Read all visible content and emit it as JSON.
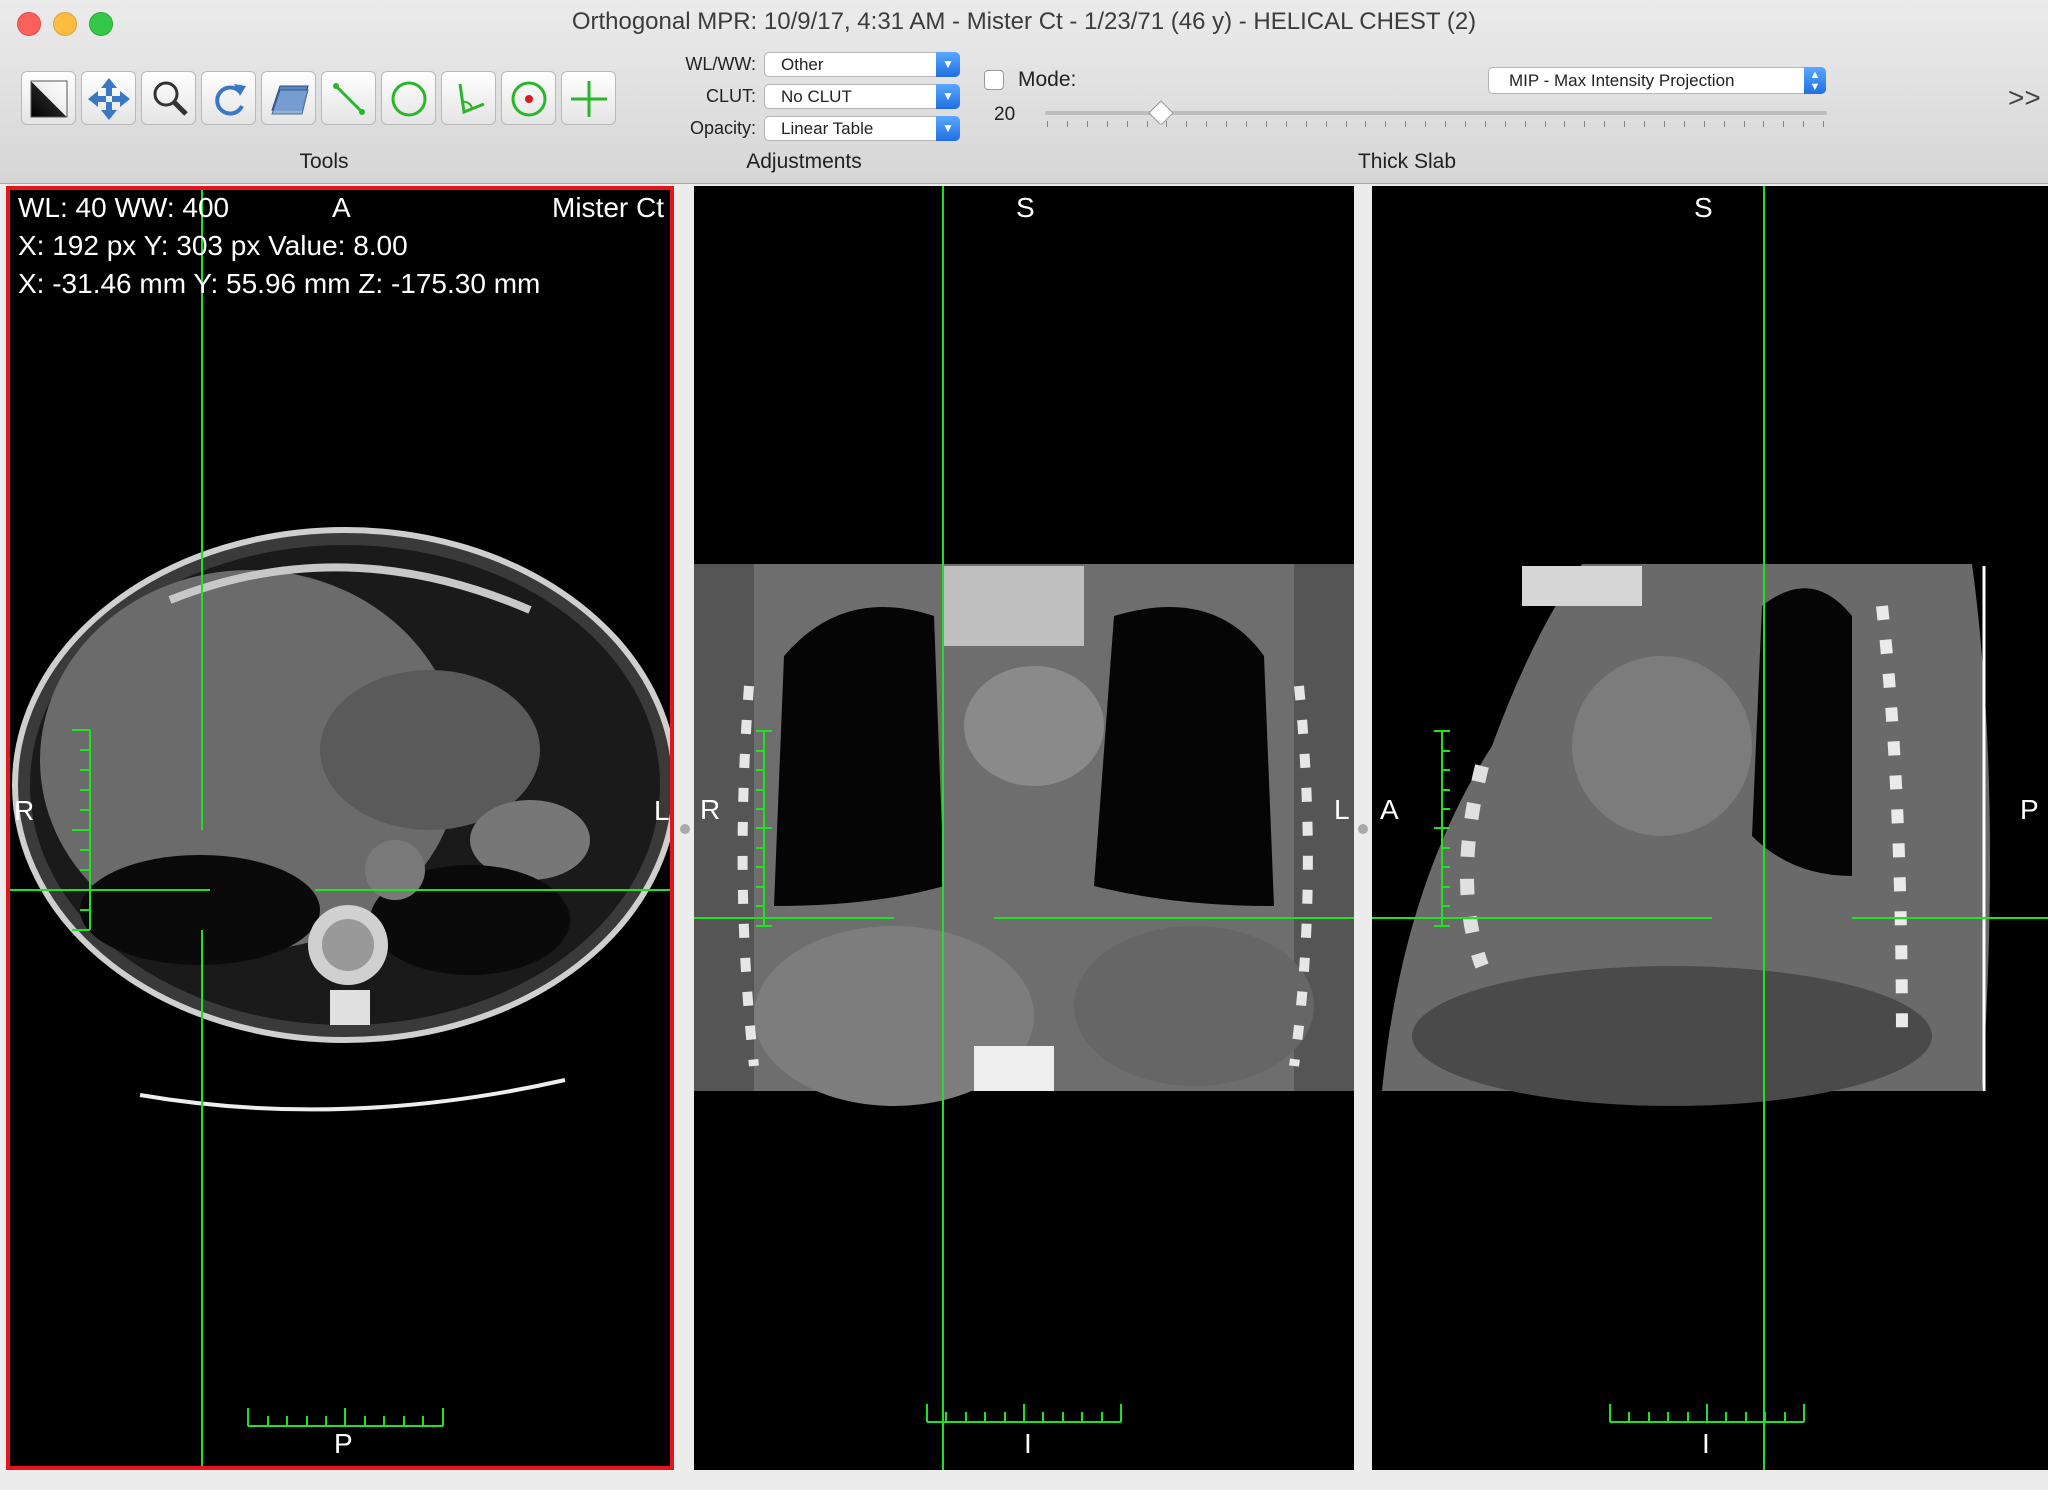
{
  "window": {
    "title": "Orthogonal MPR: 10/9/17, 4:31 AM - Mister Ct - 1/23/71 (46 y) - HELICAL CHEST (2)"
  },
  "toolbar": {
    "tools": [
      {
        "name": "wl-ww-tool-icon"
      },
      {
        "name": "move-tool-icon"
      },
      {
        "name": "zoom-tool-icon"
      },
      {
        "name": "rotate-tool-icon"
      },
      {
        "name": "slab-tool-icon"
      },
      {
        "name": "length-tool-icon"
      },
      {
        "name": "oval-roi-tool-icon"
      },
      {
        "name": "angle-tool-icon"
      },
      {
        "name": "point-tool-icon"
      },
      {
        "name": "crosshair-tool-icon"
      }
    ],
    "sections": {
      "tools_label": "Tools",
      "adjustments_label": "Adjustments",
      "thick_slab_label": "Thick Slab"
    },
    "adjustments": {
      "wlww_label": "WL/WW:",
      "wlww_value": "Other",
      "clut_label": "CLUT:",
      "clut_value": "No CLUT",
      "opacity_label": "Opacity:",
      "opacity_value": "Linear Table"
    },
    "thick_slab": {
      "mode_label": "Mode:",
      "mode_checked": false,
      "slab_value": "20",
      "projection": "MIP - Max Intensity Projection"
    },
    "more_label": ">>"
  },
  "viewports": {
    "axial": {
      "info_wl": "WL: 40 WW: 400",
      "info_px": "X: 192 px Y: 303 px Value: 8.00",
      "info_mm": "X: -31.46 mm Y: 55.96 mm Z: -175.30 mm",
      "patient": "Mister Ct",
      "top": "A",
      "bottom": "P",
      "left": "R",
      "right": "L"
    },
    "coronal": {
      "top": "S",
      "bottom": "I",
      "left": "R",
      "right": "L"
    },
    "sagittal": {
      "top": "S",
      "bottom": "I",
      "left": "A",
      "right": "P"
    }
  },
  "colors": {
    "crosshair": "#22e022",
    "active_border": "#e8141b"
  }
}
